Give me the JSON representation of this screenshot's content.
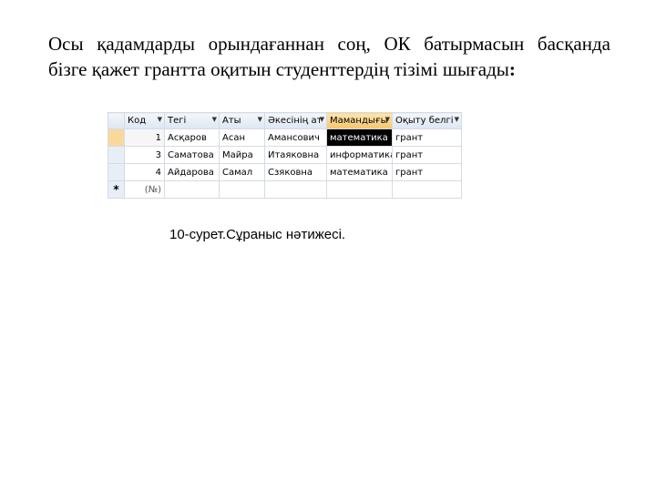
{
  "text": {
    "line1": "Осы қадамдарды орындағаннан соң, ОК батырмасын басқанда",
    "line2_normal": "бізге қажет грантта оқитын студенттердің тізімі шығады",
    "line2_bold": ":"
  },
  "grid": {
    "headers": [
      "Код",
      "Тегі",
      "Аты",
      "Әкесінің ат",
      "Мамандығы",
      "Оқыту белгі"
    ],
    "rows": [
      [
        "1",
        "Асқаров",
        "Асан",
        "Амансович",
        "математика",
        "грант"
      ],
      [
        "3",
        "Саматова",
        "Майра",
        "Итаяковна",
        "информатика",
        "грант"
      ],
      [
        "4",
        "Айдарова",
        "Самал",
        "Сзяковна",
        "математика",
        "грант"
      ]
    ],
    "new_row_marker": "*",
    "new_row_code": "(№)"
  },
  "caption": "10-сурет.Сұраныс нәтижесі."
}
